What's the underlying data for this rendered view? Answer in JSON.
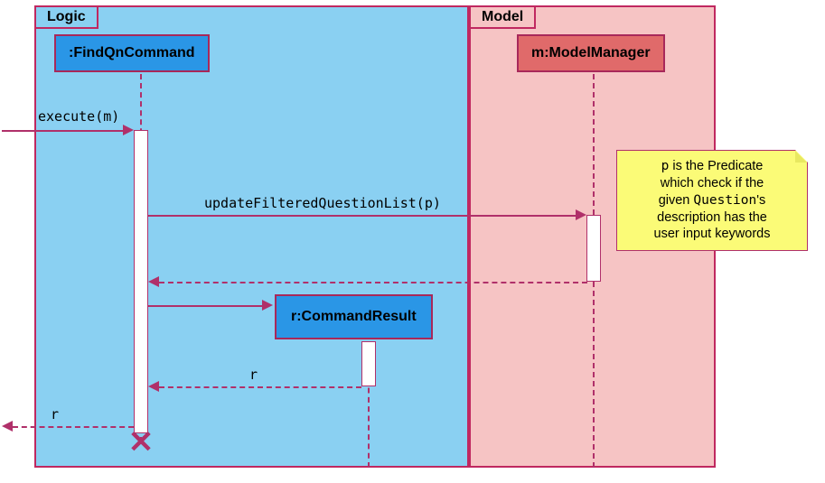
{
  "groups": {
    "logic": {
      "label": "Logic"
    },
    "model": {
      "label": "Model"
    }
  },
  "participants": {
    "findqn": {
      "label": ":FindQnCommand"
    },
    "modelmgr": {
      "label": "m:ModelManager"
    },
    "cmdresult": {
      "label": "r:CommandResult"
    }
  },
  "messages": {
    "execute": "execute(m)",
    "updateFiltered": "updateFilteredQuestionList(p)",
    "returnR1": "r",
    "returnR2": "r"
  },
  "note": {
    "line1_a": "p",
    "line1_b": " is the Predicate",
    "line2": "which check if the",
    "line3_a": "given ",
    "line3_b": "Question",
    "line3_c": "'s",
    "line4": "description has the",
    "line5": "user input keywords"
  },
  "chart_data": {
    "type": "sequence_diagram",
    "participants": [
      {
        "id": "findqn",
        "name": ":FindQnCommand",
        "group": "Logic",
        "destroyed": true
      },
      {
        "id": "cmdresult",
        "name": "r:CommandResult",
        "group": "Logic",
        "created_by": "findqn"
      },
      {
        "id": "modelmgr",
        "name": "m:ModelManager",
        "group": "Model"
      }
    ],
    "groups": [
      "Logic",
      "Model"
    ],
    "messages": [
      {
        "from": "external",
        "to": "findqn",
        "label": "execute(m)",
        "type": "sync"
      },
      {
        "from": "findqn",
        "to": "modelmgr",
        "label": "updateFilteredQuestionList(p)",
        "type": "sync"
      },
      {
        "from": "modelmgr",
        "to": "findqn",
        "label": "",
        "type": "return"
      },
      {
        "from": "findqn",
        "to": "cmdresult",
        "label": "",
        "type": "create"
      },
      {
        "from": "cmdresult",
        "to": "findqn",
        "label": "r",
        "type": "return"
      },
      {
        "from": "findqn",
        "to": "external",
        "label": "r",
        "type": "return"
      }
    ],
    "notes": [
      {
        "attached_to": "modelmgr",
        "text": "p is the Predicate which check if the given Question's description has the user input keywords"
      }
    ]
  }
}
